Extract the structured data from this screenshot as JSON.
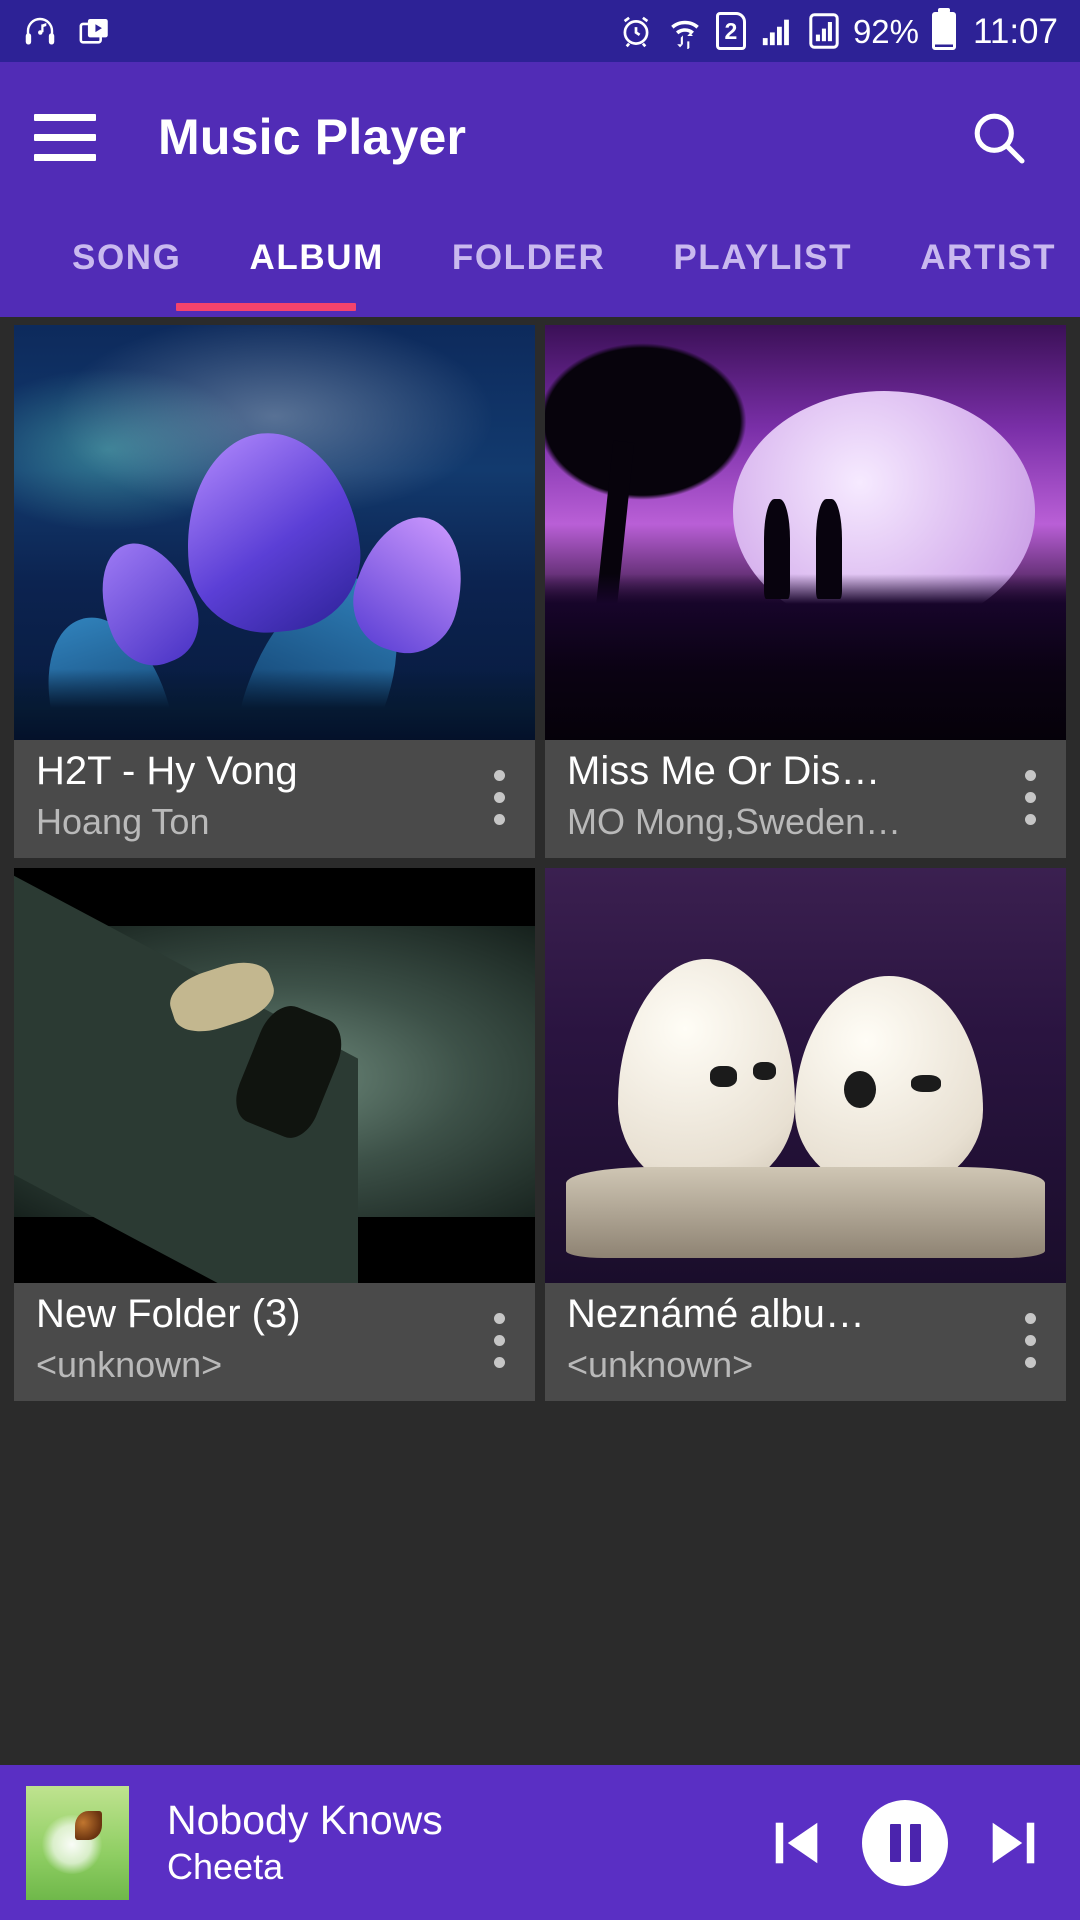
{
  "status_bar": {
    "left_icons": [
      "headphones-music-icon",
      "video-gallery-icon"
    ],
    "right_icons": [
      "alarm-icon",
      "wifi-transfer-icon",
      "sim2-icon",
      "signal-bars-icon",
      "signal-card-icon"
    ],
    "sim_label": "2",
    "battery_percent": "92%",
    "clock": "11:07",
    "background_color": "#2d2296"
  },
  "app_bar": {
    "menu_icon": "hamburger-icon",
    "title": "Music Player",
    "search_icon": "search-icon",
    "background_color": "#512cb6"
  },
  "tabs": {
    "items": [
      {
        "label": "SONG",
        "active": false
      },
      {
        "label": "ALBUM",
        "active": true
      },
      {
        "label": "FOLDER",
        "active": false
      },
      {
        "label": "PLAYLIST",
        "active": false
      },
      {
        "label": "ARTIST",
        "active": false
      }
    ],
    "active_index": 1,
    "indicator_color": "#f4436c",
    "inactive_color": "#c9b9ef",
    "active_color": "#ffffff"
  },
  "albums": [
    {
      "title": "H2T - Hy Vong",
      "subtitle": "Hoang Ton",
      "artwork": "blue-purple-flowers",
      "overflow_icon": "more-vertical-icon"
    },
    {
      "title": "Miss Me Or Dis…",
      "subtitle": "MO Mong,Sweden…",
      "artwork": "purple-moon-couple",
      "overflow_icon": "more-vertical-icon"
    },
    {
      "title": "New Folder (3)",
      "subtitle": "<unknown>",
      "artwork": "breakdancer-stage",
      "overflow_icon": "more-vertical-icon"
    },
    {
      "title": "Neznámé albu…",
      "subtitle": "<unknown>",
      "artwork": "smiling-eggs",
      "overflow_icon": "more-vertical-icon"
    }
  ],
  "now_playing": {
    "artwork": "dandelion-butterfly-thumb",
    "title": "Nobody Knows",
    "artist": "Cheeta",
    "previous_icon": "skip-previous-icon",
    "play_pause_icon": "pause-icon",
    "next_icon": "skip-next-icon",
    "background_color": "#5a2fc4",
    "is_playing": true
  },
  "theme": {
    "primary": "#512cb6",
    "status_bar": "#2d2296",
    "accent": "#f4436c",
    "grid_background": "#2b2b2b",
    "card_meta": "#4a4a4a"
  }
}
